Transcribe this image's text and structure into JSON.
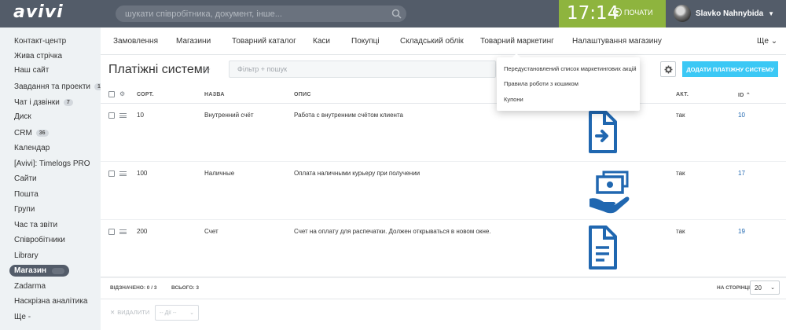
{
  "header": {
    "logo": "avivi",
    "search_placeholder": "шукати співробітника, документ, інше...",
    "clock": "17:14",
    "start_label": "ПОЧАТИ",
    "user_name": "Slavko Nahnybida",
    "colors": {
      "topbar": "#535c69",
      "clock_block": "#8eb43e"
    }
  },
  "sidebar": {
    "items": [
      {
        "label": "Контакт-центр"
      },
      {
        "label": "Жива стрічка"
      },
      {
        "label": "Наш сайт"
      },
      {
        "label": "Завдання та проекти",
        "badge": "1"
      },
      {
        "label": "Чат і дзвінки",
        "badge": "7"
      },
      {
        "label": "Диск"
      },
      {
        "label": "CRM",
        "badge": "36"
      },
      {
        "label": "Календар"
      },
      {
        "label": "[Avivi]: Timelogs PRO"
      },
      {
        "label": "Сайти"
      },
      {
        "label": "Пошта"
      },
      {
        "label": "Групи"
      },
      {
        "label": "Час та звіти"
      },
      {
        "label": "Співробітники"
      },
      {
        "label": "Library"
      },
      {
        "label": "Магазин",
        "active": true
      },
      {
        "label": "Zadarma"
      },
      {
        "label": "Наскрізна аналітика"
      },
      {
        "label": "Ще -"
      }
    ]
  },
  "tabs": [
    {
      "label": "Замовлення"
    },
    {
      "label": "Магазини"
    },
    {
      "label": "Товарний каталог"
    },
    {
      "label": "Каси"
    },
    {
      "label": "Покупці"
    },
    {
      "label": "Складський облік"
    },
    {
      "label": "Товарний маркетинг"
    },
    {
      "label": "Налаштування магазину"
    },
    {
      "label": "Ще"
    }
  ],
  "page": {
    "title": "Платіжні системи",
    "filter_placeholder": "Фільтр + пошук",
    "add_button": "ДОДАТИ ПЛАТІЖНУ СИСТЕМУ",
    "accent": "#3bc8f5"
  },
  "dropdown": {
    "items": [
      "Передустановлений список маркетингових акцій",
      "Правила роботи з кошиком",
      "Купони"
    ]
  },
  "table": {
    "headers": {
      "sort": "СОРТ.",
      "name": "НАЗВА",
      "desc": "ОПИС",
      "active": "АКТ.",
      "id": "ID"
    },
    "rows": [
      {
        "sort": "10",
        "name": "Внутренний счёт",
        "desc": "Работа с внутренним счётом клиента",
        "active": "так",
        "id": "10",
        "icon": "document-arrow-icon"
      },
      {
        "sort": "100",
        "name": "Наличные",
        "desc": "Оплата наличными курьеру при получении",
        "active": "так",
        "id": "17",
        "icon": "cash-hand-icon"
      },
      {
        "sort": "200",
        "name": "Счет",
        "desc": "Счет на оплату для распечатки. Должен открываться в новом окне.",
        "active": "так",
        "id": "19",
        "icon": "document-lines-icon"
      }
    ],
    "icon_color": "#2067b0"
  },
  "footer": {
    "selected": "ВІДЗНАЧЕНО: 0 / 3",
    "total": "ВСЬОГО: 3",
    "per_page_label": "НА СТОРІНЦІ:",
    "per_page_value": "20",
    "delete_label": "ВИДАЛИТИ",
    "actions_placeholder": "-- Дії --"
  }
}
